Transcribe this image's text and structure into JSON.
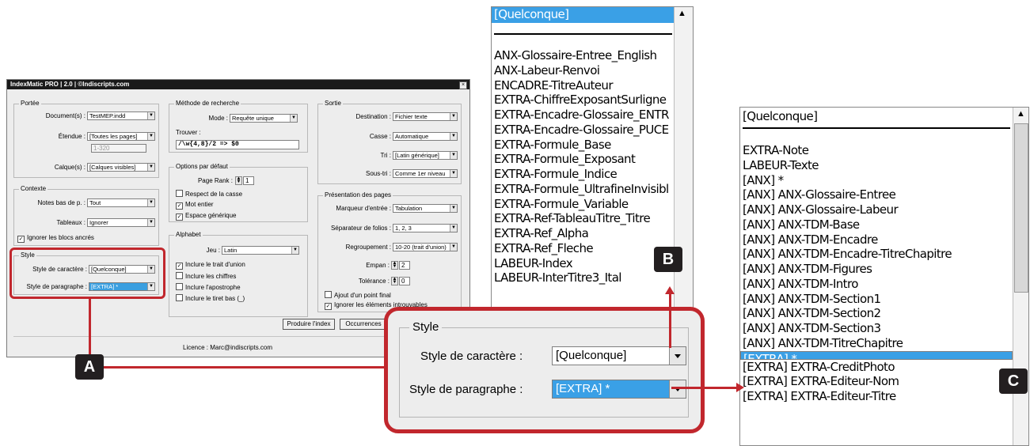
{
  "dialog": {
    "title": "IndexMatic PRO  |  2.0  |  ©Indiscripts.com",
    "close_glyph": "×",
    "portee": {
      "group": "Portée",
      "document_label": "Document(s) :",
      "document_value": "TestMEP.indd",
      "etendue_label": "Étendue :",
      "etendue_value": "[Toutes les pages]",
      "range_value": "1-320",
      "calque_label": "Calque(s) :",
      "calque_value": "[Calques visibles]"
    },
    "contexte": {
      "group": "Contexte",
      "notes_label": "Notes bas de p. :",
      "notes_value": "Tout",
      "tableaux_label": "Tableaux :",
      "tableaux_value": "Ignorer",
      "blocs_label": "Ignorer les blocs ancrés"
    },
    "style": {
      "group": "Style",
      "car_label": "Style de caractère :",
      "car_value": "[Quelconque]",
      "para_label": "Style de paragraphe :",
      "para_value": "[EXTRA] *"
    },
    "methode": {
      "group": "Méthode de recherche",
      "mode_label": "Mode :",
      "mode_value": "Requête unique",
      "trouver_label": "Trouver :",
      "trouver_value": "/\\w{4,8}/2 => $0"
    },
    "options": {
      "group": "Options par défaut",
      "rank_label": "Page Rank :",
      "rank_value": "1",
      "casse": "Respect de la casse",
      "mot": "Mot entier",
      "espace": "Espace générique"
    },
    "alphabet": {
      "group": "Alphabet",
      "jeu_label": "Jeu :",
      "jeu_value": "Latin",
      "trait": "Inclure le trait d'union",
      "chiffres": "Inclure les chiffres",
      "apostrophe": "Inclure l'apostrophe",
      "tiret": "Inclure le tiret bas (_)"
    },
    "sortie": {
      "group": "Sortie",
      "destination_label": "Destination :",
      "destination_value": "Fichier texte",
      "casse_label": "Casse :",
      "casse_value": "Automatique",
      "tri_label": "Tri :",
      "tri_value": "[Latin générique]",
      "soustri_label": "Sous-tri :",
      "soustri_value": "Comme 1er niveau"
    },
    "presentation": {
      "group": "Présentation des pages",
      "marqueur_label": "Marqueur d'entrée :",
      "marqueur_value": "Tabulation",
      "separateur_label": "Séparateur de folios :",
      "separateur_value": "1, 2, 3",
      "regroupement_label": "Regroupement :",
      "regroupement_value": "10-20  (trait d'union)",
      "empan_label": "Empan :",
      "empan_value": "2",
      "tolerance_label": "Tolérance :",
      "tolerance_value": "0",
      "ajout": "Ajout d'un point final",
      "ignorer": "Ignorer les éléments introuvables"
    },
    "produire_button": "Produire l'index",
    "occurrences_button": "Occurrences",
    "licence": "Licence :  Marc@indiscripts.com",
    "check": "✓"
  },
  "zoom": {
    "group": "Style",
    "car_label": "Style de caractère :",
    "car_value": "[Quelconque]",
    "para_label": "Style de paragraphe :",
    "para_value": "[EXTRA] *"
  },
  "listB": {
    "header": "[Quelconque]",
    "items": [
      "ANX-Glossaire-Entree_English",
      "ANX-Labeur-Renvoi",
      "ENCADRE-TitreAuteur",
      "EXTRA-ChiffreExposantSurligne",
      "EXTRA-Encadre-Glossaire_ENTR",
      "EXTRA-Encadre-Glossaire_PUCE",
      "EXTRA-Formule_Base",
      "EXTRA-Formule_Exposant",
      "EXTRA-Formule_Indice",
      "EXTRA-Formule_UltrafineInvisibl",
      "EXTRA-Formule_Variable",
      "EXTRA-Ref-TableauTitre_Titre",
      "EXTRA-Ref_Alpha",
      "EXTRA-Ref_Fleche",
      "LABEUR-Index",
      "LABEUR-InterTitre3_Ital"
    ]
  },
  "listC": {
    "header": "[Quelconque]",
    "items": [
      "EXTRA-Note",
      "LABEUR-Texte",
      "[ANX] *",
      "[ANX] ANX-Glossaire-Entree",
      "[ANX] ANX-Glossaire-Labeur",
      "[ANX] ANX-TDM-Base",
      "[ANX] ANX-TDM-Encadre",
      "[ANX] ANX-TDM-Encadre-TitreChapitre",
      "[ANX] ANX-TDM-Figures",
      "[ANX] ANX-TDM-Intro",
      "[ANX] ANX-TDM-Section1",
      "[ANX] ANX-TDM-Section2",
      "[ANX] ANX-TDM-Section3",
      "[ANX] ANX-TDM-TitreChapitre",
      "[EXTRA] *",
      "[EXTRA] EXTRA-CreditPhoto",
      "[EXTRA] EXTRA-Editeur-Nom",
      "[EXTRA] EXTRA-Editeur-Titre"
    ],
    "selected_index": 14
  },
  "badges": {
    "a": "A",
    "b": "B",
    "c": "C"
  },
  "colors": {
    "callout": "#c1272d",
    "selection": "#3aa0e6"
  },
  "icons": {
    "scroll_up": "▲",
    "dropdown": "▼"
  }
}
